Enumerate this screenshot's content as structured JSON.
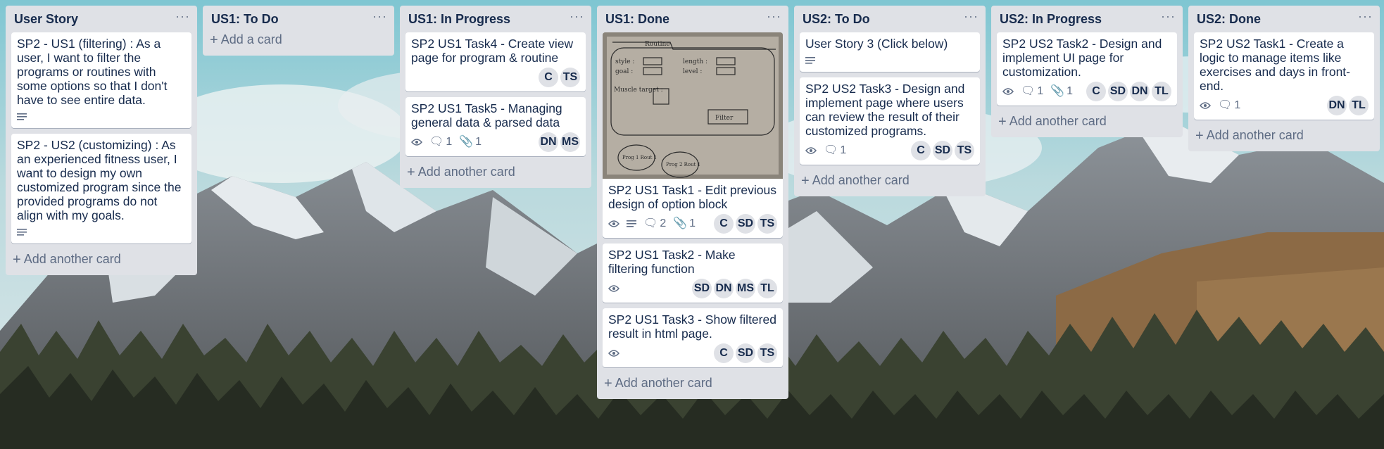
{
  "lists": [
    {
      "title": "User Story",
      "cards": [
        {
          "title": "SP2 - US1 (filtering) : As a user, I want to filter the programs or routines with some options so that I don't have to see entire data."
        },
        {
          "title": "SP2 - US2 (customizing) : As an experienced fitness user, I want to design my own customized program since the provided programs do not align with my goals."
        }
      ],
      "add_label": "Add another card"
    },
    {
      "title": "US1: To Do",
      "add_label": "Add a card"
    },
    {
      "title": "US1: In Progress",
      "cards": [
        {
          "title": "SP2 US1 Task4 - Create view page for program & routine",
          "members": [
            "C",
            "TS"
          ]
        },
        {
          "title": "SP2 US1 Task5 - Managing general data & parsed data",
          "comments": "1",
          "attachments": "1",
          "members": [
            "DN",
            "MS"
          ]
        }
      ],
      "add_label": "Add another card"
    },
    {
      "title": "US1: Done",
      "cards": [
        {
          "title": "SP2 US1 Task1 - Edit previous design of option block",
          "comments": "2",
          "attachments": "1",
          "members": [
            "C",
            "SD",
            "TS"
          ]
        },
        {
          "title": "SP2 US1 Task2 - Make filtering function",
          "members": [
            "SD",
            "DN",
            "MS",
            "TL"
          ]
        },
        {
          "title": "SP2 US1 Task3 - Show filtered result in html page.",
          "members": [
            "C",
            "SD",
            "TS"
          ]
        }
      ],
      "add_label": "Add another card"
    },
    {
      "title": "US2: To Do",
      "cards": [
        {
          "title": "User Story 3 (Click below)"
        },
        {
          "title": "SP2 US2 Task3 - Design and implement page where users can review the result of their customized programs.",
          "comments": "1",
          "members": [
            "C",
            "SD",
            "TS"
          ]
        }
      ],
      "add_label": "Add another card"
    },
    {
      "title": "US2: In Progress",
      "cards": [
        {
          "title": "SP2 US2 Task2 - Design and implement UI page for customization.",
          "comments": "1",
          "attachments": "1",
          "members": [
            "C",
            "SD",
            "DN",
            "TL"
          ]
        }
      ],
      "add_label": "Add another card"
    },
    {
      "title": "US2: Done",
      "cards": [
        {
          "title": "SP2 US2 Task1 - Create a logic to manage items like exercises and days in front-end.",
          "comments": "1",
          "members": [
            "DN",
            "TL"
          ]
        }
      ],
      "add_label": "Add another card"
    }
  ],
  "sketch": {
    "tab_label": "Routine",
    "style_label": "style :",
    "goal_label": "goal :",
    "length_label": "length :",
    "level_label": "level :",
    "target_label": "Muscle target :",
    "filter_label": "Filter",
    "prog1_label": "Prog 1 Rout 1",
    "prog2_label": "Prog 2 Rout 1"
  },
  "colors": {
    "list_bg": "#dfe1e6",
    "card_bg": "#ffffff",
    "text": "#172b4d",
    "muted": "#5e6c84"
  }
}
